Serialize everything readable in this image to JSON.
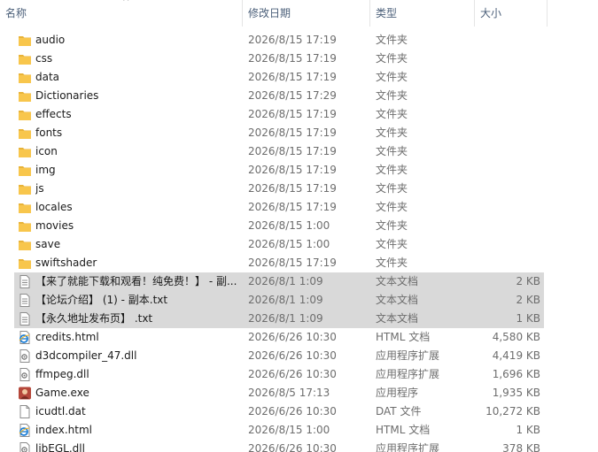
{
  "columns": {
    "name": "名称",
    "modified": "修改日期",
    "type": "类型",
    "size": "大小",
    "sort_indicator": "^"
  },
  "colors": {
    "folder": "#f8c64c",
    "selected_row": "#d9d9d9",
    "header_text": "#4c607a",
    "secondary_text": "#6d6d6d"
  },
  "files": [
    {
      "name": "audio",
      "modified": "2026/8/15 17:19",
      "type": "文件夹",
      "size": "",
      "icon": "folder-icon",
      "selected": false
    },
    {
      "name": "css",
      "modified": "2026/8/15 17:19",
      "type": "文件夹",
      "size": "",
      "icon": "folder-icon",
      "selected": false
    },
    {
      "name": "data",
      "modified": "2026/8/15 17:19",
      "type": "文件夹",
      "size": "",
      "icon": "folder-icon",
      "selected": false
    },
    {
      "name": "Dictionaries",
      "modified": "2026/8/15 17:29",
      "type": "文件夹",
      "size": "",
      "icon": "folder-icon",
      "selected": false
    },
    {
      "name": "effects",
      "modified": "2026/8/15 17:19",
      "type": "文件夹",
      "size": "",
      "icon": "folder-icon",
      "selected": false
    },
    {
      "name": "fonts",
      "modified": "2026/8/15 17:19",
      "type": "文件夹",
      "size": "",
      "icon": "folder-icon",
      "selected": false
    },
    {
      "name": "icon",
      "modified": "2026/8/15 17:19",
      "type": "文件夹",
      "size": "",
      "icon": "folder-icon",
      "selected": false
    },
    {
      "name": "img",
      "modified": "2026/8/15 17:19",
      "type": "文件夹",
      "size": "",
      "icon": "folder-icon",
      "selected": false
    },
    {
      "name": "js",
      "modified": "2026/8/15 17:19",
      "type": "文件夹",
      "size": "",
      "icon": "folder-icon",
      "selected": false
    },
    {
      "name": "locales",
      "modified": "2026/8/15 17:19",
      "type": "文件夹",
      "size": "",
      "icon": "folder-icon",
      "selected": false
    },
    {
      "name": "movies",
      "modified": "2026/8/15 1:00",
      "type": "文件夹",
      "size": "",
      "icon": "folder-icon",
      "selected": false
    },
    {
      "name": "save",
      "modified": "2026/8/15 1:00",
      "type": "文件夹",
      "size": "",
      "icon": "folder-icon",
      "selected": false
    },
    {
      "name": "swiftshader",
      "modified": "2026/8/15 17:19",
      "type": "文件夹",
      "size": "",
      "icon": "folder-icon",
      "selected": false
    },
    {
      "name": "【来了就能下载和观看！纯免费！】 - 副...",
      "modified": "2026/8/1 1:09",
      "type": "文本文档",
      "size": "2 KB",
      "icon": "text-file-icon",
      "selected": true
    },
    {
      "name": "【论坛介绍】 (1) - 副本.txt",
      "modified": "2026/8/1 1:09",
      "type": "文本文档",
      "size": "2 KB",
      "icon": "text-file-icon",
      "selected": true
    },
    {
      "name": "【永久地址发布页】 .txt",
      "modified": "2026/8/1 1:09",
      "type": "文本文档",
      "size": "1 KB",
      "icon": "text-file-icon",
      "selected": true
    },
    {
      "name": "credits.html",
      "modified": "2026/6/26 10:30",
      "type": "HTML 文档",
      "size": "4,580 KB",
      "icon": "ie-html-icon",
      "selected": false
    },
    {
      "name": "d3dcompiler_47.dll",
      "modified": "2026/6/26 10:30",
      "type": "应用程序扩展",
      "size": "4,419 KB",
      "icon": "dll-file-icon",
      "selected": false
    },
    {
      "name": "ffmpeg.dll",
      "modified": "2026/6/26 10:30",
      "type": "应用程序扩展",
      "size": "1,696 KB",
      "icon": "dll-file-icon",
      "selected": false
    },
    {
      "name": "Game.exe",
      "modified": "2026/8/5 17:13",
      "type": "应用程序",
      "size": "1,935 KB",
      "icon": "game-exe-icon",
      "selected": false
    },
    {
      "name": "icudtl.dat",
      "modified": "2026/6/26 10:30",
      "type": "DAT 文件",
      "size": "10,272 KB",
      "icon": "blank-file-icon",
      "selected": false
    },
    {
      "name": "index.html",
      "modified": "2026/8/15 1:00",
      "type": "HTML 文档",
      "size": "1 KB",
      "icon": "ie-html-icon",
      "selected": false
    },
    {
      "name": "libEGL.dll",
      "modified": "2026/6/26 10:30",
      "type": "应用程序扩展",
      "size": "378 KB",
      "icon": "dll-file-icon",
      "selected": false
    }
  ]
}
